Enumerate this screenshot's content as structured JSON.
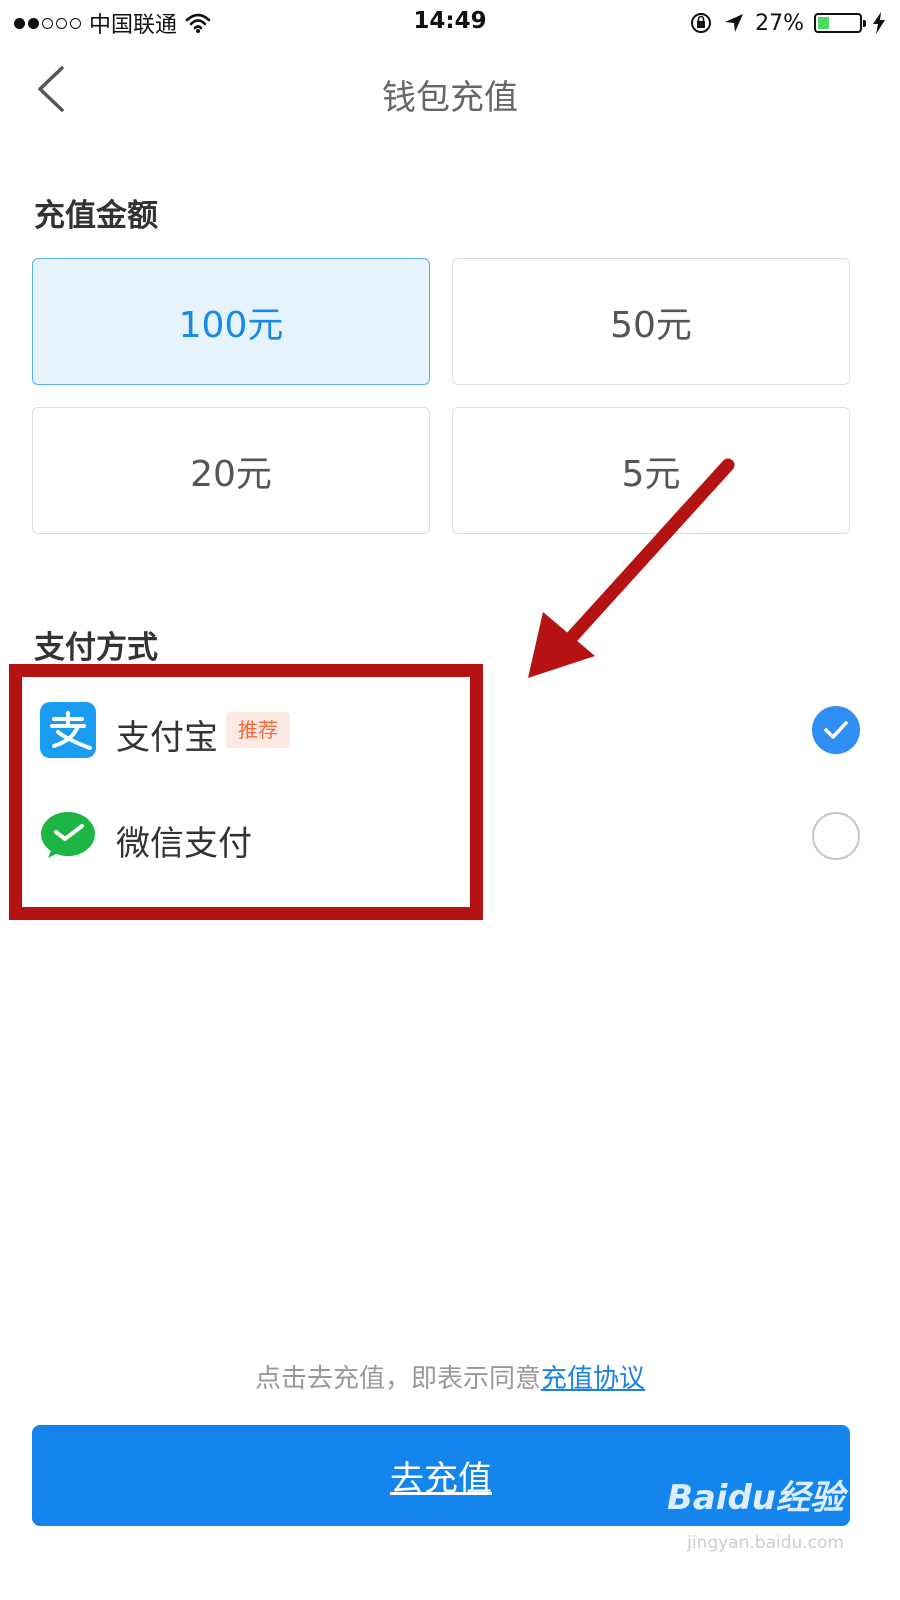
{
  "status_bar": {
    "carrier": "中国联通",
    "time": "14:49",
    "battery": "27%",
    "battery_level": 0.27
  },
  "nav": {
    "title": "钱包充值"
  },
  "amount": {
    "label": "充值金额",
    "options": [
      "100元",
      "50元",
      "20元",
      "5元"
    ],
    "selected_index": 0
  },
  "payment": {
    "label": "支付方式",
    "methods": [
      {
        "name": "支付宝",
        "badge": "推荐",
        "checked": true
      },
      {
        "name": "微信支付",
        "checked": false
      }
    ]
  },
  "agreement": {
    "text": "点击去充值，即表示同意",
    "link": "充值协议"
  },
  "submit": {
    "label": "去充值"
  },
  "watermark": {
    "main": "Baidu经验",
    "sub": "jingyan.baidu.com"
  },
  "colors": {
    "accent": "#1585ee",
    "highlight": "#b51313",
    "badge": "#f06a40"
  }
}
